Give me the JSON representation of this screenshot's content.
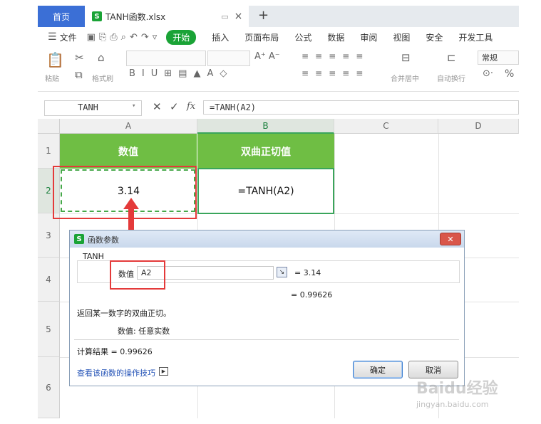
{
  "tabs": {
    "home": "首页",
    "file_name": "TANH函数.xlsx",
    "s_logo": "S",
    "new_tab": "+"
  },
  "menu": {
    "file": "文件",
    "items": [
      "开始",
      "插入",
      "页面布局",
      "公式",
      "数据",
      "审阅",
      "视图",
      "安全",
      "开发工具"
    ]
  },
  "ribbon": {
    "paste": "粘贴",
    "format_painter": "格式刷",
    "merge_center": "合并居中",
    "wrap_text": "自动换行",
    "number_format": "常规",
    "percent": "%"
  },
  "formula_bar": {
    "name_box": "TANH",
    "fx": "fx",
    "formula": "=TANH(A2)"
  },
  "sheet": {
    "columns": [
      "A",
      "B",
      "C",
      "D"
    ],
    "rows": [
      "1",
      "2",
      "3",
      "4",
      "5",
      "6"
    ],
    "a1": "数值",
    "b1": "双曲正切值",
    "a2": "3.14",
    "b2": "=TANH(A2)",
    "header_fill": "#6fbe44",
    "highlight": "#e43a3a"
  },
  "dialog": {
    "title": "函数参数",
    "func_name": "TANH",
    "arg_label": "数值",
    "arg_value": "A2",
    "arg_result": "= 3.14",
    "func_result": "= 0.99626",
    "description": "返回某一数字的双曲正切。",
    "param_help": "数值:  任意实数",
    "calc_result": "计算结果 = 0.99626",
    "help_link": "查看该函数的操作技巧",
    "ok": "确定",
    "cancel": "取消"
  },
  "watermark": {
    "brand": "Baidu经验",
    "url": "jingyan.baidu.com"
  }
}
